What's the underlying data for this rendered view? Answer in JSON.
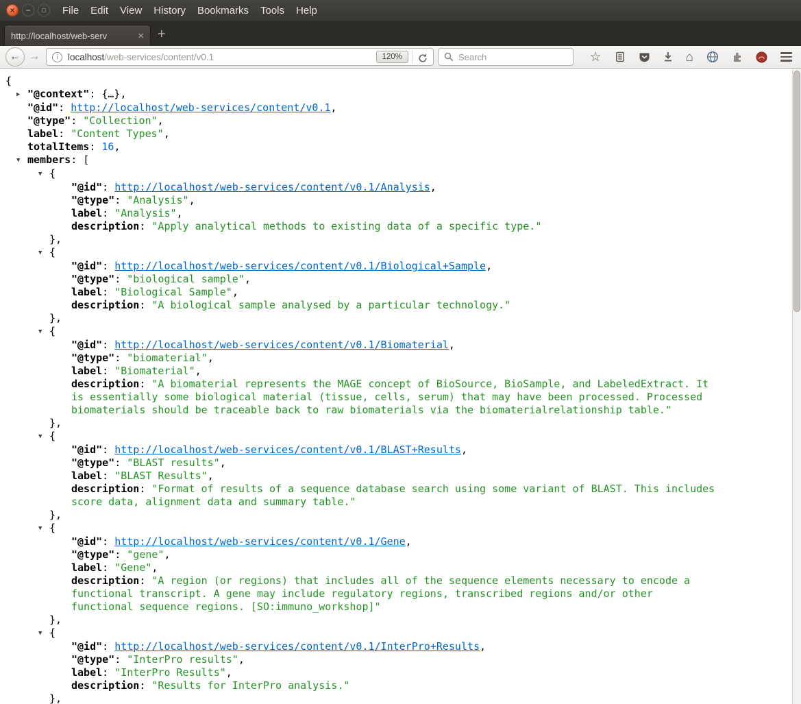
{
  "window": {
    "menu": [
      "File",
      "Edit",
      "View",
      "History",
      "Bookmarks",
      "Tools",
      "Help"
    ],
    "controls": {
      "close": "×",
      "minimize": "−",
      "maximize": "□"
    }
  },
  "tabbar": {
    "active_tab_title": "http://localhost/web-serv",
    "tab_close": "×",
    "new_tab": "+"
  },
  "navbar": {
    "back": "←",
    "forward": "→",
    "info": "i",
    "url_host": "localhost",
    "url_path": "/web-services/content/v0.1",
    "zoom_level": "120%",
    "search_placeholder": "Search",
    "icons": {
      "star": "☆",
      "home": "⌂"
    }
  },
  "colors": {
    "link_blue": "#0066cc",
    "string_green": "#259425",
    "number_blue": "#0066cc",
    "key_black": "#000000",
    "ubuntu_close_orange": "#de4f23",
    "titlebar_gray": "#3a3834"
  },
  "json_doc": {
    "punct": {
      "open_brace": "{",
      "open_bracket": "[",
      "close_brace_comma": "},",
      "collapsed_preview": ": {…},",
      "colon": ": ",
      "comma": ",",
      "twisty_collapsed": "▶",
      "twisty_expanded": "▼"
    },
    "root": {
      "context_key": "\"@context\"",
      "id_key": "\"@id\"",
      "id_url": "http://localhost/web-services/content/v0.1",
      "type_key": "\"@type\"",
      "type_value": "\"Collection\"",
      "label_key": "label",
      "label_value": "\"Content Types\"",
      "total_key": "totalItems",
      "total_value": "16",
      "members_key": "members"
    },
    "member_keys": {
      "id": "\"@id\"",
      "type": "\"@type\"",
      "label": "label",
      "description": "description"
    },
    "members": [
      {
        "id_url": "http://localhost/web-services/content/v0.1/Analysis",
        "type_value": "\"Analysis\"",
        "label_value": "\"Analysis\"",
        "description_value": "\"Apply analytical methods to existing data of a specific type.\""
      },
      {
        "id_url": "http://localhost/web-services/content/v0.1/Biological+Sample",
        "type_value": "\"biological sample\"",
        "label_value": "\"Biological Sample\"",
        "description_value": "\"A biological sample analysed by a particular technology.\""
      },
      {
        "id_url": "http://localhost/web-services/content/v0.1/Biomaterial",
        "type_value": "\"biomaterial\"",
        "label_value": "\"Biomaterial\"",
        "description_value": "\"A biomaterial represents the MAGE concept of BioSource, BioSample, and LabeledExtract. It is essentially some biological material (tissue, cells, serum) that may have been processed. Processed biomaterials should be traceable back to raw biomaterials via the biomaterialrelationship table.\""
      },
      {
        "id_url": "http://localhost/web-services/content/v0.1/BLAST+Results",
        "type_value": "\"BLAST results\"",
        "label_value": "\"BLAST Results\"",
        "description_value": "\"Format of results of a sequence database search using some variant of BLAST. This includes score data, alignment data and summary table.\""
      },
      {
        "id_url": "http://localhost/web-services/content/v0.1/Gene",
        "type_value": "\"gene\"",
        "label_value": "\"Gene\"",
        "description_value": "\"A region (or regions) that includes all of the sequence elements necessary to encode a functional transcript. A gene may include regulatory regions, transcribed regions and/or other functional sequence regions. [SO:immuno_workshop]\""
      },
      {
        "id_url": "http://localhost/web-services/content/v0.1/InterPro+Results",
        "type_value": "\"InterPro results\"",
        "label_value": "\"InterPro Results\"",
        "description_value": "\"Results for InterPro analysis.\""
      }
    ]
  }
}
